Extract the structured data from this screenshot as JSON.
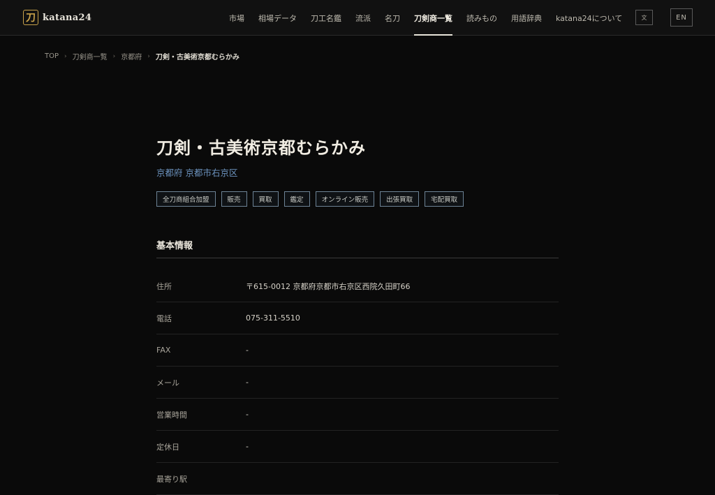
{
  "header": {
    "logo_mark": "刀",
    "logo_text": "katana24",
    "nav": [
      {
        "label": "市場"
      },
      {
        "label": "相場データ"
      },
      {
        "label": "刀工名鑑"
      },
      {
        "label": "流派"
      },
      {
        "label": "名刀"
      },
      {
        "label": "刀剣商一覧",
        "active": true
      },
      {
        "label": "読みもの"
      },
      {
        "label": "用語辞典"
      },
      {
        "label": "katana24について"
      }
    ],
    "lang_toggle_label": "文",
    "lang_en_label": "EN"
  },
  "breadcrumb": {
    "items": [
      "TOP",
      "刀剣商一覧",
      "京都府"
    ],
    "current": "刀剣・古美術京都むらかみ",
    "separator": "›"
  },
  "dealer": {
    "name": "刀剣・古美術京都むらかみ",
    "location": "京都府 京都市右京区",
    "tags": [
      "全刀商組合加盟",
      "販売",
      "買取",
      "鑑定",
      "オンライン販売",
      "出張買取",
      "宅配買取"
    ]
  },
  "basic_info": {
    "heading": "基本情報",
    "rows": [
      {
        "label": "住所",
        "value": "〒615-0012 京都府京都市右京区西院久田町66"
      },
      {
        "label": "電話",
        "value": "075-311-5510"
      },
      {
        "label": "FAX",
        "value": "-"
      },
      {
        "label": "メール",
        "value": "-"
      },
      {
        "label": "営業時間",
        "value": "-"
      },
      {
        "label": "定休日",
        "value": "-"
      },
      {
        "label": "最寄り駅",
        "value": ""
      }
    ]
  },
  "colors": {
    "background": "#0a0a0a",
    "accent_gold": "#c9a24a",
    "location_blue": "#6c93bf",
    "tag_border": "#6d8396"
  }
}
